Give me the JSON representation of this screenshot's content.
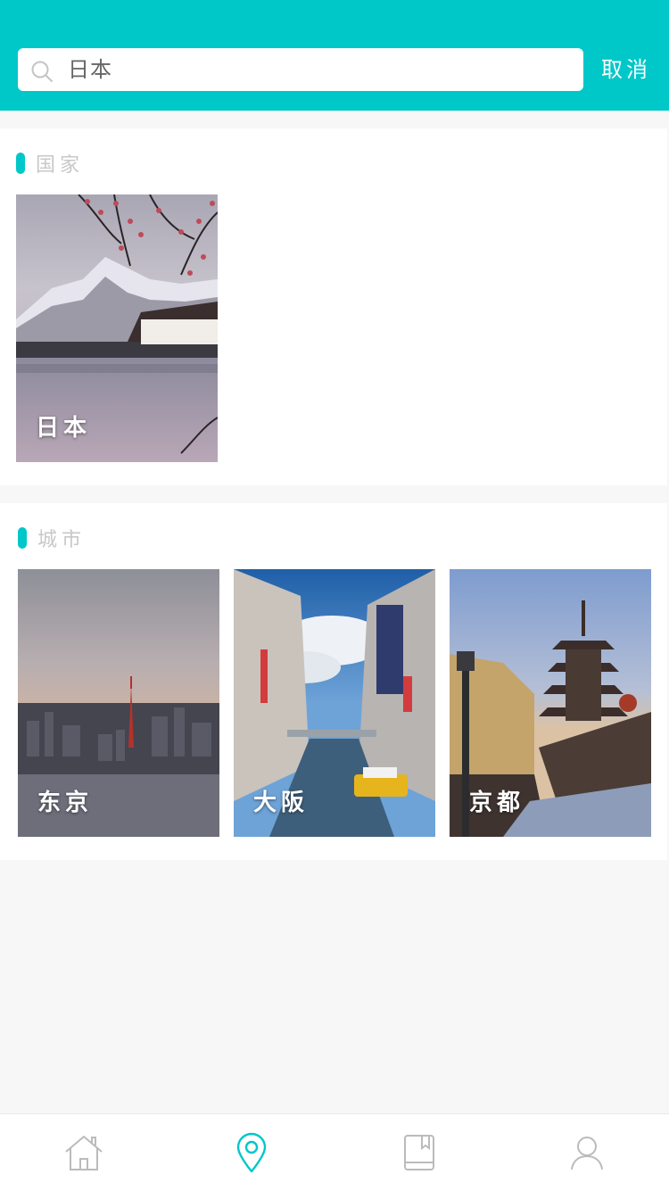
{
  "search": {
    "value": "日本",
    "cancel_label": "取消"
  },
  "sections": {
    "country": {
      "title": "国家",
      "items": [
        {
          "label": "日本"
        }
      ]
    },
    "city": {
      "title": "城市",
      "items": [
        {
          "label": "东京"
        },
        {
          "label": "大阪"
        },
        {
          "label": "京都"
        }
      ]
    }
  },
  "tabbar": {
    "items": [
      {
        "icon": "home-icon",
        "active": false
      },
      {
        "icon": "location-pin-icon",
        "active": true
      },
      {
        "icon": "book-icon",
        "active": false
      },
      {
        "icon": "user-icon",
        "active": false
      }
    ]
  },
  "colors": {
    "accent": "#00c7c8",
    "inactive_icon": "#bbbbbb",
    "section_title": "#c8c8c8"
  }
}
